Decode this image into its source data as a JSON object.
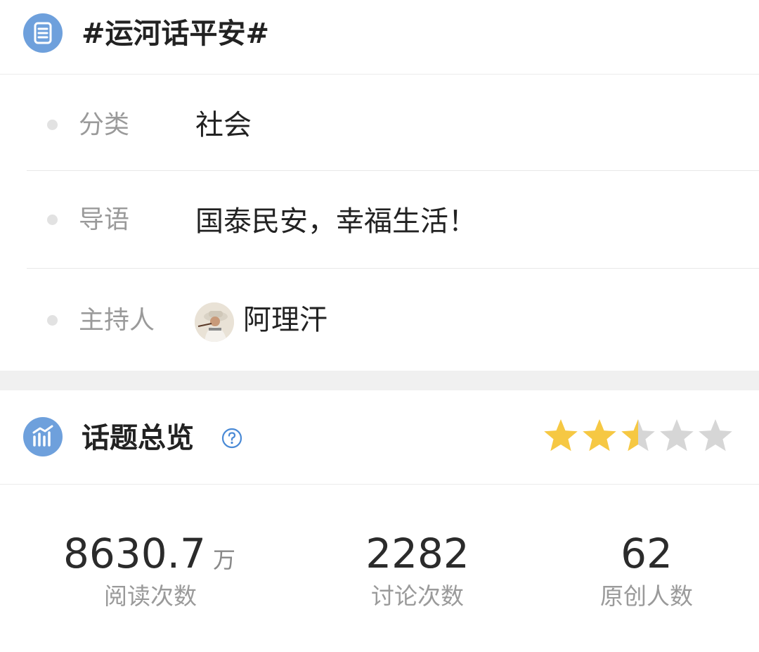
{
  "header": {
    "icon": "list-icon",
    "title": "#运河话平安#"
  },
  "info": {
    "category": {
      "label": "分类",
      "value": "社会"
    },
    "intro": {
      "label": "导语",
      "value": "国泰民安，幸福生活！"
    },
    "host": {
      "label": "主持人",
      "name": "阿理汗",
      "avatar": "avatar-photo"
    }
  },
  "overview": {
    "icon": "bar-chart-icon",
    "title": "话题总览",
    "help_icon": "question-circle-icon",
    "rating": {
      "value": 2.5,
      "max": 5,
      "filled_color": "#f6c843",
      "empty_color": "#d6d6d6"
    }
  },
  "stats": [
    {
      "value": "8630.7",
      "unit": "万",
      "label": "阅读次数"
    },
    {
      "value": "2282",
      "label": "讨论次数"
    },
    {
      "value": "62",
      "label": "原创人数"
    }
  ],
  "colors": {
    "accent": "#6ea0dc",
    "help": "#4a8ad6",
    "divider": "#e8e8e8",
    "band": "#f0f0f0"
  }
}
